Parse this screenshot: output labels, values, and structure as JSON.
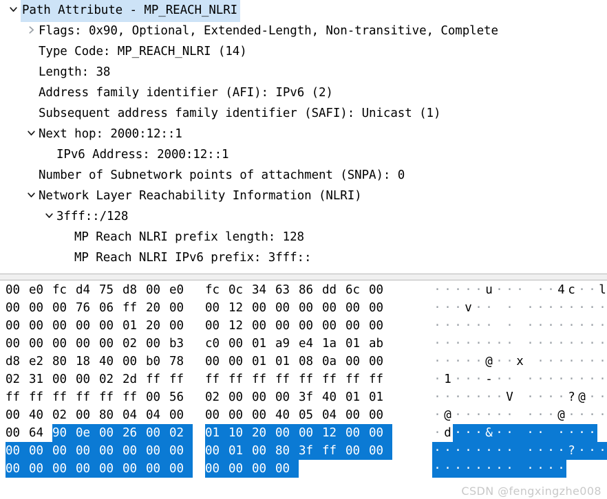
{
  "colors": {
    "selection_blue": "#0b7ad4",
    "row_highlight": "#cde3f7",
    "dot_gray": "#9aa0a6",
    "splitter": "#f0f0f0",
    "watermark": "#c9c9c9"
  },
  "detail_tree": {
    "rows": [
      {
        "indent": 0,
        "chevron": "chevron-down",
        "selected": true,
        "label": "Path Attribute - MP_REACH_NLRI"
      },
      {
        "indent": 1,
        "chevron": "chevron-right",
        "selected": false,
        "label": "Flags: 0x90, Optional, Extended-Length, Non-transitive, Complete"
      },
      {
        "indent": 1,
        "chevron": "none",
        "selected": false,
        "label": "Type Code: MP_REACH_NLRI (14)"
      },
      {
        "indent": 1,
        "chevron": "none",
        "selected": false,
        "label": "Length: 38"
      },
      {
        "indent": 1,
        "chevron": "none",
        "selected": false,
        "label": "Address family identifier (AFI): IPv6 (2)"
      },
      {
        "indent": 1,
        "chevron": "none",
        "selected": false,
        "label": "Subsequent address family identifier (SAFI): Unicast (1)"
      },
      {
        "indent": 1,
        "chevron": "chevron-down",
        "selected": false,
        "label": "Next hop: 2000:12::1"
      },
      {
        "indent": 2,
        "chevron": "none",
        "selected": false,
        "label": "IPv6 Address: 2000:12::1"
      },
      {
        "indent": 1,
        "chevron": "none",
        "selected": false,
        "label": "Number of Subnetwork points of attachment (SNPA): 0"
      },
      {
        "indent": 1,
        "chevron": "chevron-down",
        "selected": false,
        "label": "Network Layer Reachability Information (NLRI)"
      },
      {
        "indent": 2,
        "chevron": "chevron-down",
        "selected": false,
        "label": "3fff::/128"
      },
      {
        "indent": 3,
        "chevron": "none",
        "selected": false,
        "label": "MP Reach NLRI prefix length: 128"
      },
      {
        "indent": 3,
        "chevron": "none",
        "selected": false,
        "label": "MP Reach NLRI IPv6 prefix: 3fff::"
      }
    ]
  },
  "hex_dump": {
    "rows": [
      {
        "bytes": [
          "00",
          "e0",
          "fc",
          "d4",
          "75",
          "d8",
          "00",
          "e0",
          "fc",
          "0c",
          "34",
          "63",
          "86",
          "dd",
          "6c",
          "00"
        ],
        "ascii": [
          "·",
          "·",
          "·",
          "·",
          "·",
          "u",
          "·",
          "·",
          "·",
          "·",
          "·",
          "4",
          "c",
          "·",
          "·",
          "l",
          "·"
        ],
        "ascii_text": "·····u···  ··4c··l·",
        "selected_from": -1,
        "selected_to": -1
      },
      {
        "bytes": [
          "00",
          "00",
          "00",
          "76",
          "06",
          "ff",
          "20",
          "00",
          "00",
          "12",
          "00",
          "00",
          "00",
          "00",
          "00",
          "00"
        ],
        "ascii_text": "···v··  ·  ········",
        "selected_from": -1,
        "selected_to": -1
      },
      {
        "bytes": [
          "00",
          "00",
          "00",
          "00",
          "00",
          "01",
          "20",
          "00",
          "00",
          "12",
          "00",
          "00",
          "00",
          "00",
          "00",
          "00"
        ],
        "ascii_text": "······  ·  ········",
        "selected_from": -1,
        "selected_to": -1
      },
      {
        "bytes": [
          "00",
          "00",
          "00",
          "00",
          "00",
          "02",
          "00",
          "b3",
          "c0",
          "00",
          "01",
          "a9",
          "e4",
          "1a",
          "01",
          "ab"
        ],
        "ascii_text": "········  ········",
        "selected_from": -1,
        "selected_to": -1
      },
      {
        "bytes": [
          "d8",
          "e2",
          "80",
          "18",
          "40",
          "00",
          "b0",
          "78",
          "00",
          "00",
          "01",
          "01",
          "08",
          "0a",
          "00",
          "00"
        ],
        "ascii_text": "·····@··x ········",
        "selected_from": -1,
        "selected_to": -1
      },
      {
        "bytes": [
          "02",
          "31",
          "00",
          "00",
          "02",
          "2d",
          "ff",
          "ff",
          "ff",
          "ff",
          "ff",
          "ff",
          "ff",
          "ff",
          "ff",
          "ff"
        ],
        "ascii_text": "·1···-··  ········",
        "selected_from": -1,
        "selected_to": -1
      },
      {
        "bytes": [
          "ff",
          "ff",
          "ff",
          "ff",
          "ff",
          "ff",
          "00",
          "56",
          "02",
          "00",
          "00",
          "00",
          "3f",
          "40",
          "01",
          "01"
        ],
        "ascii_text": "·······V  ····?@··",
        "selected_from": -1,
        "selected_to": -1
      },
      {
        "bytes": [
          "00",
          "40",
          "02",
          "00",
          "80",
          "04",
          "04",
          "00",
          "00",
          "00",
          "00",
          "40",
          "05",
          "04",
          "00",
          "00"
        ],
        "ascii_text": "·@······  ···@····",
        "selected_from": -1,
        "selected_to": -1
      },
      {
        "bytes": [
          "00",
          "64",
          "90",
          "0e",
          "00",
          "26",
          "00",
          "02",
          "01",
          "10",
          "20",
          "00",
          "00",
          "12",
          "00",
          "00"
        ],
        "ascii_text": "·d···&··  ··  ····",
        "selected_from": 2,
        "selected_to": 15
      },
      {
        "bytes": [
          "00",
          "00",
          "00",
          "00",
          "00",
          "00",
          "00",
          "00",
          "00",
          "01",
          "00",
          "80",
          "3f",
          "ff",
          "00",
          "00"
        ],
        "ascii_text": "········  ····?···",
        "selected_from": 0,
        "selected_to": 15
      },
      {
        "bytes": [
          "00",
          "00",
          "00",
          "00",
          "00",
          "00",
          "00",
          "00",
          "00",
          "00",
          "00",
          "00"
        ],
        "ascii_text": "········  ····",
        "selected_from": 0,
        "selected_to": 11
      }
    ],
    "ascii_rows": [
      {
        "chars": [
          ".",
          ".",
          ".",
          ".",
          ".",
          "u",
          ".",
          ".",
          ".",
          "|",
          ".",
          ".",
          "4",
          "c",
          ".",
          ".",
          "l",
          "."
        ],
        "sel_from": -1,
        "sel_to": -1
      },
      {
        "chars": [
          ".",
          ".",
          ".",
          "v",
          ".",
          ".",
          "|",
          ".",
          "|",
          ".",
          ".",
          ".",
          ".",
          ".",
          ".",
          ".",
          ".",
          "."
        ],
        "sel_from": -1,
        "sel_to": -1
      },
      {
        "chars": [
          ".",
          ".",
          ".",
          ".",
          ".",
          ".",
          "|",
          ".",
          "|",
          ".",
          ".",
          ".",
          ".",
          ".",
          ".",
          ".",
          ".",
          "."
        ],
        "sel_from": -1,
        "sel_to": -1
      },
      {
        "chars": [
          ".",
          ".",
          ".",
          ".",
          ".",
          ".",
          ".",
          ".",
          "|",
          ".",
          ".",
          ".",
          ".",
          ".",
          ".",
          ".",
          ".",
          "."
        ],
        "sel_from": -1,
        "sel_to": -1
      },
      {
        "chars": [
          ".",
          ".",
          ".",
          ".",
          ".",
          "@",
          ".",
          ".",
          "x",
          "|",
          ".",
          ".",
          ".",
          ".",
          ".",
          ".",
          ".",
          "."
        ],
        "sel_from": -1,
        "sel_to": -1
      },
      {
        "chars": [
          ".",
          "1",
          ".",
          ".",
          ".",
          "-",
          ".",
          ".",
          "|",
          ".",
          ".",
          ".",
          ".",
          ".",
          ".",
          ".",
          ".",
          "."
        ],
        "sel_from": -1,
        "sel_to": -1
      },
      {
        "chars": [
          ".",
          ".",
          ".",
          ".",
          ".",
          ".",
          ".",
          "V",
          "|",
          ".",
          ".",
          ".",
          ".",
          "?",
          "@",
          ".",
          "."
        ],
        "sel_from": -1,
        "sel_to": -1
      },
      {
        "chars": [
          ".",
          "@",
          ".",
          ".",
          ".",
          ".",
          ".",
          ".",
          "|",
          ".",
          ".",
          ".",
          "@",
          ".",
          ".",
          ".",
          "."
        ],
        "sel_from": -1,
        "sel_to": -1
      },
      {
        "chars": [
          ".",
          "d",
          ".",
          ".",
          ".",
          "&",
          ".",
          ".",
          "|",
          ".",
          ".",
          "|",
          ".",
          ".",
          ".",
          "."
        ],
        "sel_from": 2,
        "sel_to": 15
      },
      {
        "chars": [
          ".",
          ".",
          ".",
          ".",
          ".",
          ".",
          ".",
          ".",
          "|",
          ".",
          ".",
          ".",
          ".",
          "?",
          ".",
          ".",
          "."
        ],
        "sel_from": 0,
        "sel_to": 16
      },
      {
        "chars": [
          ".",
          ".",
          ".",
          ".",
          ".",
          ".",
          ".",
          ".",
          "|",
          ".",
          ".",
          ".",
          "."
        ],
        "sel_from": 0,
        "sel_to": 12
      }
    ]
  },
  "watermark": {
    "text": "CSDN @fengxingzhe008"
  }
}
